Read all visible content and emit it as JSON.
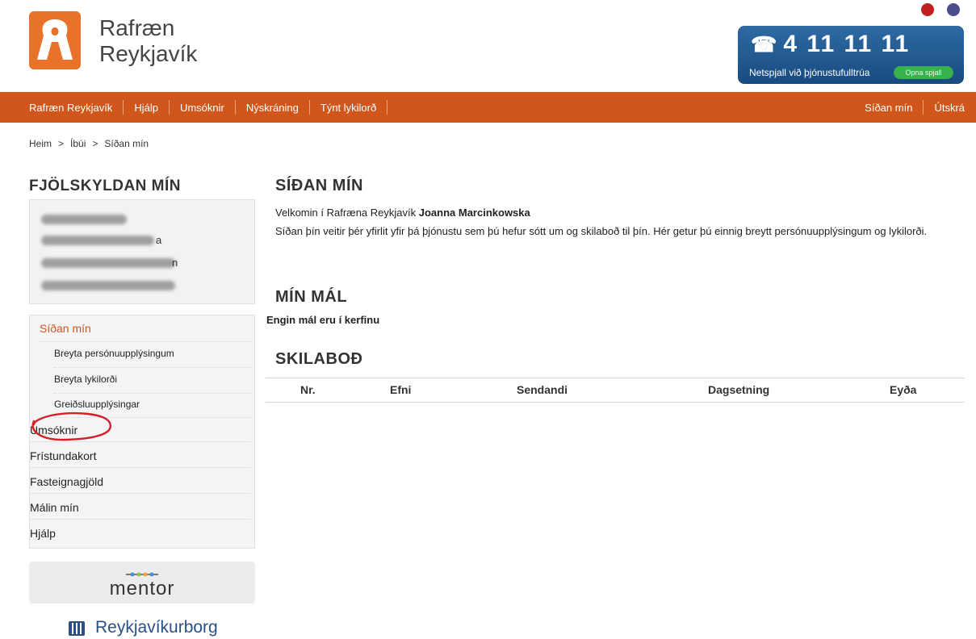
{
  "header": {
    "logo_line1": "Rafræn",
    "logo_line2": "Reykjavík",
    "phone_icon": "telephone-icon",
    "phone_number": "4 11 11 11",
    "chat_label": "Netspjall við þjónustufulltrúa",
    "chat_button": "Opna spjall"
  },
  "nav": {
    "left": [
      "Rafræn Reykjavík",
      "Hjálp",
      "Umsóknir",
      "Nýskráning",
      "Týnt lykilorð"
    ],
    "right": [
      "Síðan mín",
      "Útskrá"
    ]
  },
  "breadcrumb": [
    "Heim",
    "Íbúi",
    "Síðan mín"
  ],
  "family": {
    "title": "FJÖLSKYLDAN MÍN",
    "members": [
      {
        "visible_suffix": ""
      },
      {
        "visible_suffix": "a"
      },
      {
        "visible_suffix": "n"
      },
      {
        "visible_suffix": ""
      }
    ]
  },
  "sidebar": {
    "active": "Síðan mín",
    "sub_items": [
      "Breyta persónuupplýsingum",
      "Breyta lykilorði",
      "Greiðsluupplýsingar"
    ],
    "items": [
      "Umsóknir",
      "Frístundakort",
      "Fasteignagjöld",
      "Málin mín",
      "Hjálp"
    ]
  },
  "footer_logos": {
    "mentor": "mentor",
    "city": "Reykjavíkurborg"
  },
  "main": {
    "page_title": "SÍÐAN MÍN",
    "welcome_prefix": "Velkomin í Rafræna Reykjavík",
    "user_name": "Joanna Marcinkowska",
    "intro": "Síðan þín veitir þér yfirlit yfir þá þjónustu sem þú hefur sótt um og skilaboð til þín. Hér getur þú einnig breytt persónuupplýsingum og lykilorði.",
    "cases_title": "MÍN MÁL",
    "no_cases": "Engin mál eru í kerfinu",
    "messages_title": "SKILABOÐ",
    "columns": [
      "Nr.",
      "Efni",
      "Sendandi",
      "Dagsetning",
      "Eyða"
    ]
  },
  "colors": {
    "brand_orange": "#d0561b",
    "phone_blue": "#1e5a94",
    "chat_green": "#37b24d",
    "annotation_red": "#d21f2a"
  }
}
